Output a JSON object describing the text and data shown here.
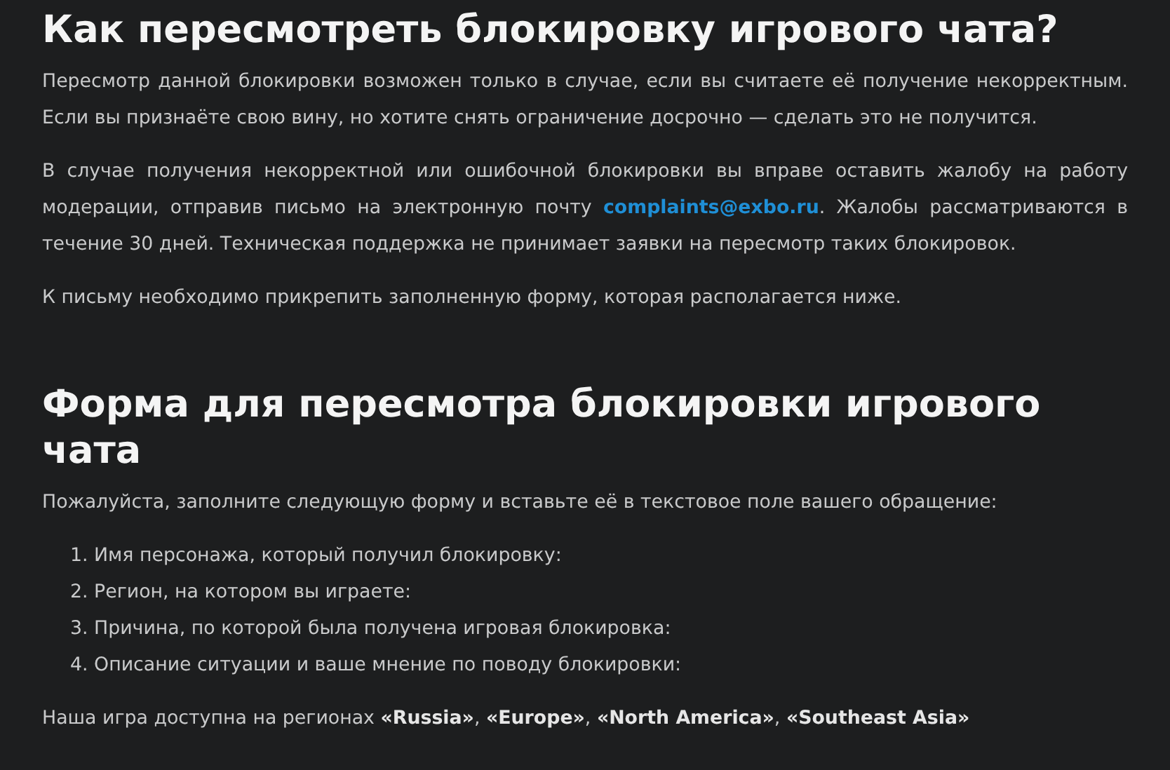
{
  "sections": [
    {
      "heading": "Как пересмотреть блокировку игрового чата?",
      "blocks": [
        {
          "kind": "paragraph",
          "text": "Пересмотр данной блокировки возможен только в случае, если вы считаете её получение некорректным. Если вы признаёте свою вину, но хотите снять ограничение досрочно — сделать это не получится."
        },
        {
          "kind": "linked",
          "before": "В случае получения некорректной или ошибочной блокировки вы вправе оставить жалобу на работу модерации, отправив письмо на электронную почту ",
          "link": "complaints@exbo.ru",
          "after": ". Жалобы рассматриваются в течение 30 дней. Техническая поддержка не принимает заявки на пересмотр таких блокировок."
        },
        {
          "kind": "paragraph",
          "text": "К письму необходимо прикрепить заполненную форму, которая располагается ниже."
        }
      ]
    },
    {
      "heading": "Форма для пересмотра блокировки игрового чата",
      "blocks": [
        {
          "kind": "paragraph",
          "text": "Пожалуйста, заполните следующую форму и вставьте её в текстовое поле вашего обращение:"
        },
        {
          "kind": "list",
          "items": [
            {
              "number": "1.",
              "text": "Имя персонажа, который получил блокировку:"
            },
            {
              "number": "2.",
              "text": "Регион, на котором вы играете:"
            },
            {
              "number": "3.",
              "text": "Причина, по которой была получена игровая блокировка:"
            },
            {
              "number": "4.",
              "text": "Описание ситуации и ваше мнение по поводу блокировки:"
            }
          ]
        },
        {
          "kind": "paragraph",
          "text": "Наша игра доступна на регионах **«Russia»**, **«Europe»**, **«North America»**, **«Southeast Asia»**"
        }
      ]
    }
  ]
}
